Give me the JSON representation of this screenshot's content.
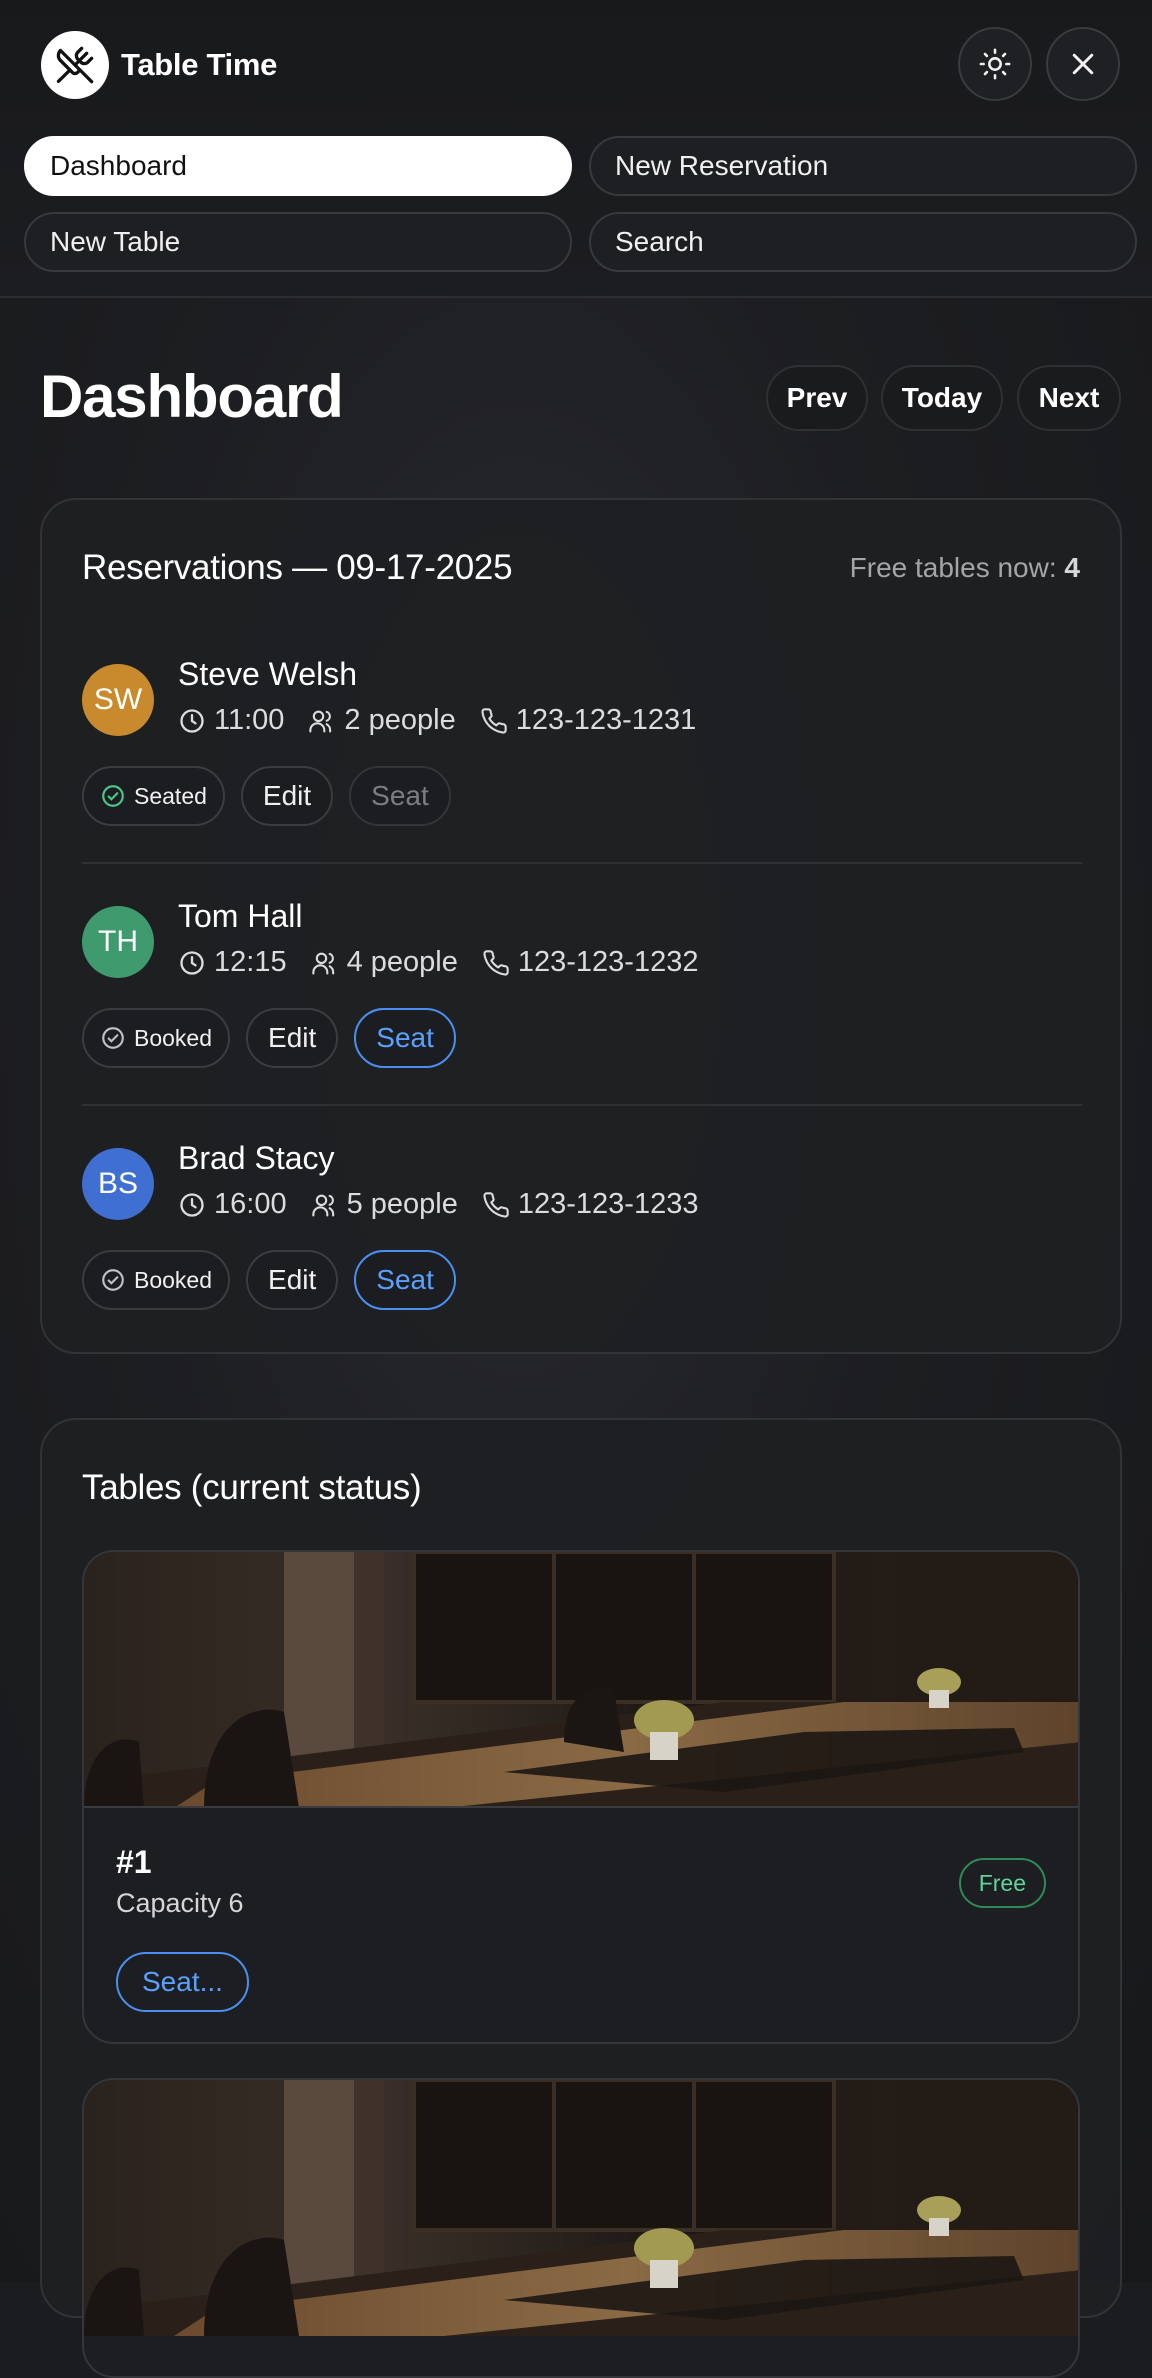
{
  "app": {
    "name": "Table Time"
  },
  "nav": {
    "items": [
      {
        "label": "Dashboard",
        "active": true
      },
      {
        "label": "New Reservation",
        "active": false
      },
      {
        "label": "New Table",
        "active": false
      },
      {
        "label": "Search",
        "active": false
      }
    ]
  },
  "page": {
    "title": "Dashboard",
    "date_nav": {
      "prev": "Prev",
      "today": "Today",
      "next": "Next"
    }
  },
  "reservations": {
    "title": "Reservations — 09-17-2025",
    "free_label": "Free tables now:",
    "free_count": "4",
    "items": [
      {
        "initials": "SW",
        "name": "Steve Welsh",
        "time": "11:00",
        "people": "2 people",
        "phone": "123-123-1231",
        "status": "Seated",
        "edit": "Edit",
        "seat": "Seat",
        "seat_enabled": false,
        "avatar_color": "#c98a2e"
      },
      {
        "initials": "TH",
        "name": "Tom Hall",
        "time": "12:15",
        "people": "4 people",
        "phone": "123-123-1232",
        "status": "Booked",
        "edit": "Edit",
        "seat": "Seat",
        "seat_enabled": true,
        "avatar_color": "#3f9a6e"
      },
      {
        "initials": "BS",
        "name": "Brad Stacy",
        "time": "16:00",
        "people": "5 people",
        "phone": "123-123-1233",
        "status": "Booked",
        "edit": "Edit",
        "seat": "Seat",
        "seat_enabled": true,
        "avatar_color": "#3f6fd0"
      }
    ]
  },
  "tables": {
    "title": "Tables (current status)",
    "items": [
      {
        "number": "#1",
        "capacity": "Capacity 6",
        "status": "Free",
        "action": "Seat..."
      }
    ]
  },
  "colors": {
    "accent_blue": "#5aa0ff",
    "free_green": "#5fd39a",
    "seated_green": "#4fc489"
  },
  "icons": [
    "utensils-crossed-icon",
    "sun-icon",
    "close-icon",
    "clock-icon",
    "users-icon",
    "phone-icon",
    "check-circle-icon"
  ]
}
